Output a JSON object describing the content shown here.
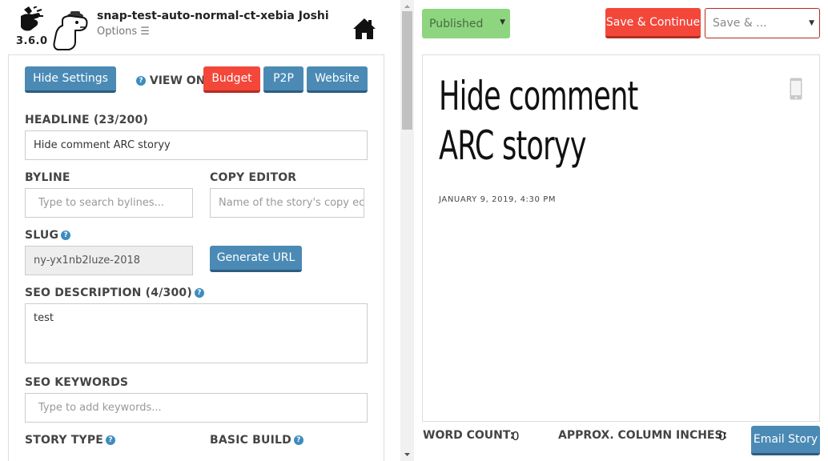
{
  "app": {
    "version": "3.6.0",
    "site_title": "snap-test-auto-normal-ct-xebia Joshi",
    "options_label": "Options ☰"
  },
  "settings": {
    "hide_settings_label": "Hide Settings",
    "view_on_label": "VIEW ON",
    "view_on_targets": [
      "Budget",
      "P2P",
      "Website"
    ],
    "headline_label": "HEADLINE (23/200)",
    "headline_value": "Hide comment ARC storyy",
    "byline_label": "BYLINE",
    "byline_placeholder": "Type to search bylines...",
    "copy_editor_label": "COPY EDITOR",
    "copy_editor_placeholder": "Name of the story's copy ec",
    "slug_label": "SLUG",
    "slug_value": "ny-yx1nb2luze-2018",
    "generate_url_label": "Generate URL",
    "seo_description_label": "SEO DESCRIPTION (4/300)",
    "seo_description_value": "test",
    "seo_keywords_label": "SEO KEYWORDS",
    "seo_keywords_placeholder": "Type to add keywords...",
    "story_type_label": "STORY TYPE",
    "basic_build_label": "BASIC BUILD"
  },
  "toolbar": {
    "status_value": "Published",
    "save_continue_label": "Save & Continue",
    "save_menu_value": "Save & ..."
  },
  "preview": {
    "title": "Hide comment ARC storyy",
    "date": "JANUARY 9, 2019, 4:30 PM"
  },
  "footer": {
    "word_count_label": "WORD COUNT:",
    "word_count_value": "0",
    "column_inches_label": "APPROX. COLUMN INCHES:",
    "column_inches_value": "0",
    "email_story_label": "Email Story"
  },
  "colors": {
    "blue_button": "#4a8ab5",
    "red_button": "#f3473a",
    "published_green": "#8dd67f"
  }
}
